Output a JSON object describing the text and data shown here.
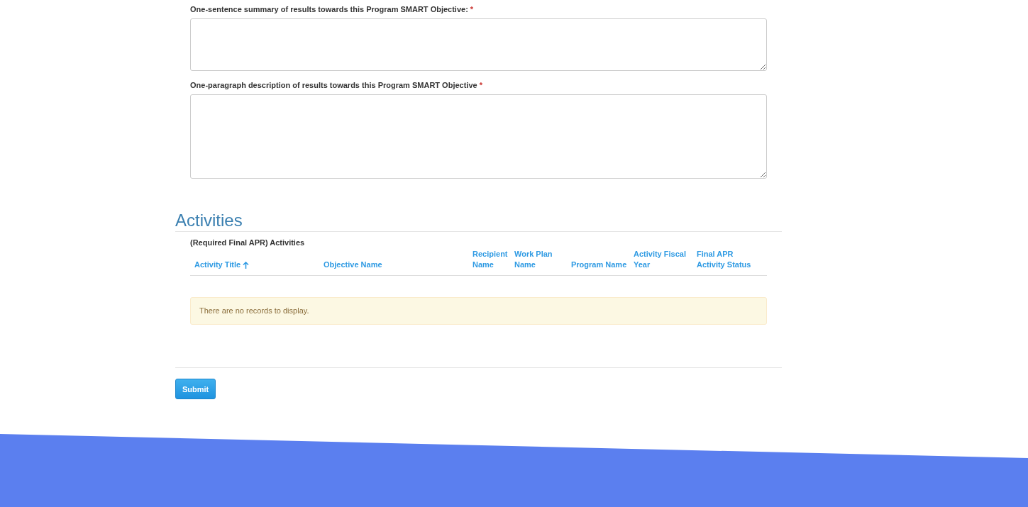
{
  "fields": [
    {
      "label": "One-sentence summary of results towards this Program SMART Objective:",
      "required_mark": "*"
    },
    {
      "label": "One-paragraph description of results towards this Program SMART Objective",
      "required_mark": "*"
    }
  ],
  "activities": {
    "heading": "Activities",
    "subtitle": "(Required Final APR) Activities",
    "columns": [
      {
        "label": "Activity Title",
        "sorted": true
      },
      {
        "label": "Objective Name",
        "sorted": false
      },
      {
        "label": "Recipient Name",
        "sorted": false
      },
      {
        "label": "Work Plan Name",
        "sorted": false
      },
      {
        "label": "Program Name",
        "sorted": false
      },
      {
        "label": "Activity Fiscal Year",
        "sorted": false
      },
      {
        "label": "Final APR Activity Status",
        "sorted": false
      }
    ],
    "empty_message": "There are no records to display."
  },
  "submit_button": "Submit"
}
